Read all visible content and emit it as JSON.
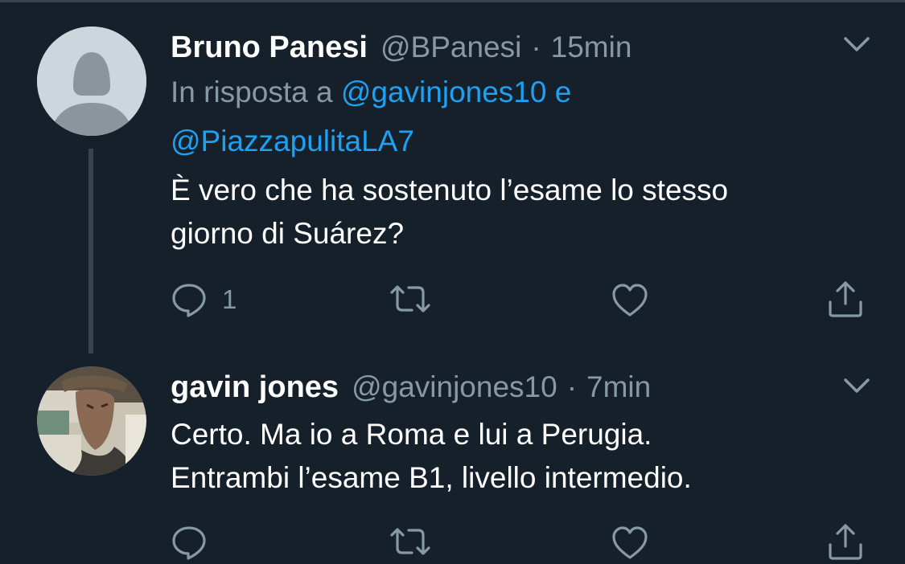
{
  "colors": {
    "background": "#15202b",
    "secondary_text": "#8899a6",
    "link": "#1da1f2",
    "divider": "#38444d"
  },
  "tweets": [
    {
      "author_name": "Bruno Panesi",
      "handle": "@BPanesi",
      "separator": "·",
      "time": "15min",
      "reply_prefix": "In risposta a",
      "reply_mention_1": "@gavinjones10",
      "reply_conj": "e",
      "reply_mention_2": "@PiazzapulitaLA7",
      "text_line_1": "È vero che ha sostenuto l’esame lo stesso",
      "text_line_2": "giorno di Suárez?",
      "reply_count": "1",
      "avatar": "default-avatar"
    },
    {
      "author_name": "gavin jones",
      "handle": "@gavinjones10",
      "separator": "·",
      "time": "7min",
      "text_line_1": "Certo. Ma io a Roma e lui a Perugia.",
      "text_line_2": "Entrambi l’esame B1, livello intermedio.",
      "avatar": "profile-photo"
    }
  ],
  "icons": [
    "chevron-down-icon",
    "reply-icon",
    "retweet-icon",
    "like-icon",
    "share-icon"
  ]
}
